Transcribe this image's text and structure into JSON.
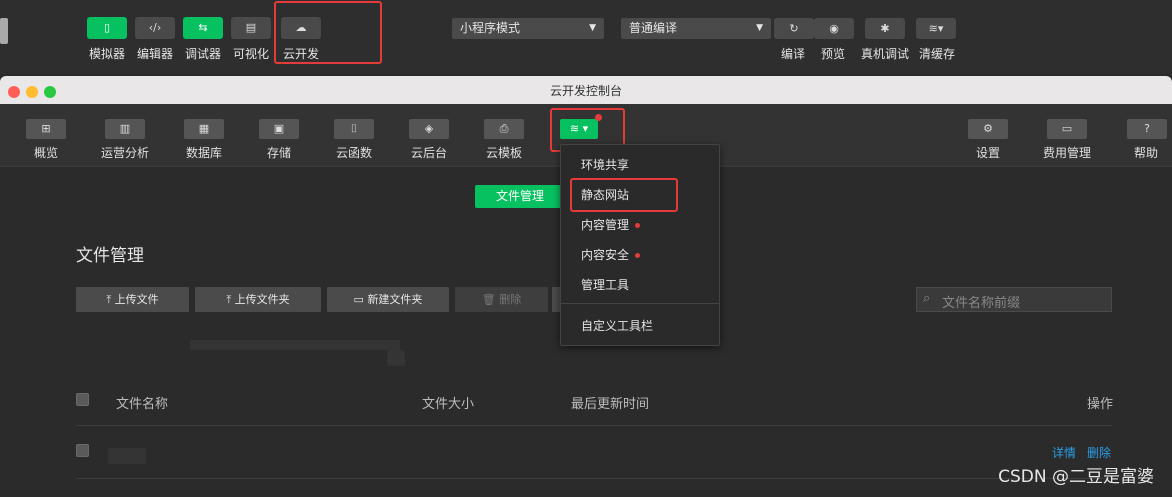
{
  "ide_toolbar": {
    "buttons": [
      {
        "label": "模拟器",
        "icon": "phone-icon",
        "active": true
      },
      {
        "label": "编辑器",
        "icon": "code-icon",
        "active": false
      },
      {
        "label": "调试器",
        "icon": "debug-icon",
        "active": true
      },
      {
        "label": "可视化",
        "icon": "layout-icon",
        "active": false
      },
      {
        "label": "云开发",
        "icon": "cloud-icon",
        "active": false
      }
    ],
    "mode_select": "小程序模式",
    "compile_select": "普通编译",
    "right_buttons": [
      {
        "label": "编译",
        "icon": "refresh-icon"
      },
      {
        "label": "预览",
        "icon": "eye-icon"
      },
      {
        "label": "真机调试",
        "icon": "bug-icon"
      },
      {
        "label": "清缓存",
        "icon": "layers-icon"
      }
    ]
  },
  "window": {
    "title": "云开发控制台"
  },
  "console_nav": {
    "items": [
      {
        "label": "概览",
        "icon": "grid-icon"
      },
      {
        "label": "运营分析",
        "icon": "bar-chart-icon"
      },
      {
        "label": "数据库",
        "icon": "database-icon"
      },
      {
        "label": "存储",
        "icon": "storage-icon"
      },
      {
        "label": "云函数",
        "icon": "function-icon"
      },
      {
        "label": "云后台",
        "icon": "cube-icon"
      },
      {
        "label": "云模板",
        "icon": "template-icon"
      }
    ],
    "right_items": [
      {
        "label": "设置",
        "icon": "gear-icon"
      },
      {
        "label": "费用管理",
        "icon": "wallet-icon"
      },
      {
        "label": "帮助",
        "icon": "help-icon"
      }
    ]
  },
  "main": {
    "tab_active": "文件管理",
    "heading": "文件管理",
    "actions": {
      "upload_file": "上传文件",
      "upload_folder": "上传文件夹",
      "new_folder": "新建文件夹",
      "delete": "删除"
    },
    "search_placeholder": "文件名称前缀",
    "table": {
      "headers": [
        "文件名称",
        "文件大小",
        "最后更新时间",
        "操作"
      ],
      "row_actions": [
        "详情",
        "删除"
      ]
    }
  },
  "dropdown": {
    "items": [
      {
        "label": "环境共享",
        "dot": false
      },
      {
        "label": "静态网站",
        "dot": false,
        "highlighted": true
      },
      {
        "label": "内容管理",
        "dot": true
      },
      {
        "label": "内容安全",
        "dot": true
      },
      {
        "label": "管理工具",
        "dot": false
      }
    ],
    "footer_item": "自定义工具栏"
  },
  "watermark": "CSDN @二豆是富婆",
  "colors": {
    "accent_green": "#07c160",
    "highlight_red": "#e43a3a",
    "link_blue": "#2a9ee8"
  }
}
